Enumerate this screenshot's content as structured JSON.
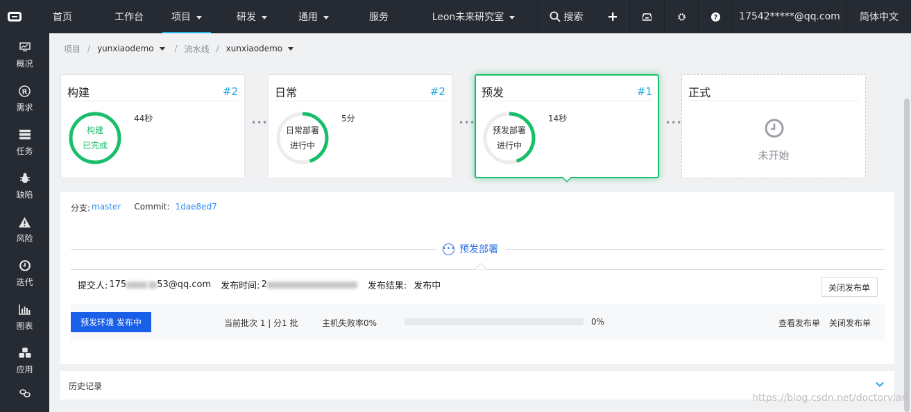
{
  "topbar": {
    "nav": [
      {
        "label": "首页",
        "dropdown": false,
        "active": false
      },
      {
        "label": "工作台",
        "dropdown": false,
        "active": false
      },
      {
        "label": "项目",
        "dropdown": true,
        "active": true
      },
      {
        "label": "研发",
        "dropdown": true,
        "active": false
      },
      {
        "label": "通用",
        "dropdown": true,
        "active": false
      },
      {
        "label": "服务",
        "dropdown": false,
        "active": false
      }
    ],
    "team": "Leon未来研究室",
    "search_label": "搜索",
    "account": "17542*****@qq.com",
    "language": "简体中文"
  },
  "sidebar": {
    "items": [
      {
        "label": "概况",
        "icon": "monitor-icon"
      },
      {
        "label": "需求",
        "icon": "registered-icon"
      },
      {
        "label": "任务",
        "icon": "task-list-icon"
      },
      {
        "label": "缺陷",
        "icon": "bug-icon"
      },
      {
        "label": "风险",
        "icon": "warning-icon"
      },
      {
        "label": "迭代",
        "icon": "clock-icon"
      },
      {
        "label": "图表",
        "icon": "bar-chart-icon"
      },
      {
        "label": "应用",
        "icon": "cubes-icon"
      }
    ]
  },
  "breadcrumb": {
    "root": "项目",
    "project": "yunxiaodemo",
    "section": "流水线",
    "pipeline": "xunxiaodemo"
  },
  "stages": [
    {
      "title": "构建",
      "num": "#2",
      "line1": "构建",
      "line2": "已完成",
      "duration": "44秒",
      "progress": 1.0,
      "status": "done"
    },
    {
      "title": "日常",
      "num": "#2",
      "line1": "日常部署",
      "line2": "进行中",
      "duration": "5分",
      "progress": 0.45,
      "status": "running"
    },
    {
      "title": "预发",
      "num": "#1",
      "line1": "预发部署",
      "line2": "进行中",
      "duration": "14秒",
      "progress": 0.45,
      "status": "running"
    },
    {
      "title": "正式",
      "num": "",
      "line1": "",
      "line2": "",
      "duration": "",
      "progress": 0,
      "status": "pending",
      "pending_label": "未开始"
    }
  ],
  "detail": {
    "branch_label": "分支:",
    "branch": "master",
    "commit_label": "Commit:",
    "commit": "1dae8ed7",
    "section_label": "预发部署",
    "submitter_label": "提交人:",
    "submitter_start": "175",
    "submitter_end": "53@qq.com",
    "time_label": "发布时间:",
    "time_start": "2",
    "result_label": "发布结果:",
    "result": "发布中",
    "close_button": "关闭发布单",
    "env_button": "预发环境 发布中",
    "batch_text": "当前批次 1 | 分1 批",
    "fail_rate_text": "主机失败率0%",
    "progress_percent": "0%",
    "progress_value": 0,
    "view_link": "查看发布单",
    "close_link": "关闭发布单"
  },
  "history": {
    "label": "历史记录"
  },
  "watermark": "https://blog.csdn.net/doctorvian",
  "colors": {
    "success": "#19be6b",
    "link": "#2d8cf0",
    "primary": "#1a5fe8",
    "topbar": "#262b33"
  }
}
